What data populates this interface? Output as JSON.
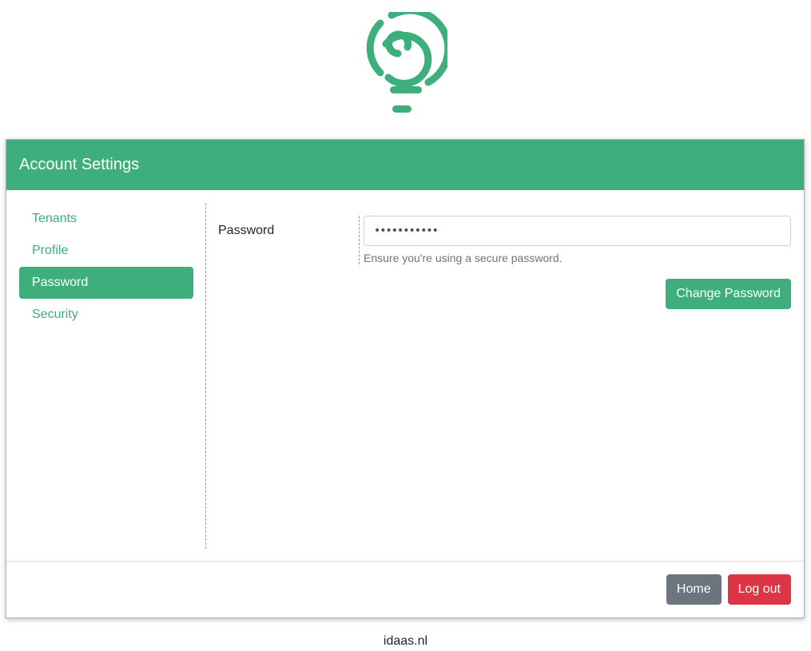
{
  "brand": {
    "logo_icon": "spiral-lightbulb-icon",
    "accent_color": "#3eaf7c"
  },
  "card": {
    "title": "Account Settings"
  },
  "sidebar": {
    "items": [
      {
        "label": "Tenants",
        "active": false
      },
      {
        "label": "Profile",
        "active": false
      },
      {
        "label": "Password",
        "active": true
      },
      {
        "label": "Security",
        "active": false
      }
    ]
  },
  "password_form": {
    "label": "Password",
    "value": "•••••••••••",
    "help_text": "Ensure you're using a secure password.",
    "submit_label": "Change Password"
  },
  "footer_actions": {
    "home_label": "Home",
    "logout_label": "Log out",
    "home_color": "#6c757d",
    "logout_color": "#dc3545"
  },
  "site_footer": {
    "text": "idaas.nl"
  }
}
